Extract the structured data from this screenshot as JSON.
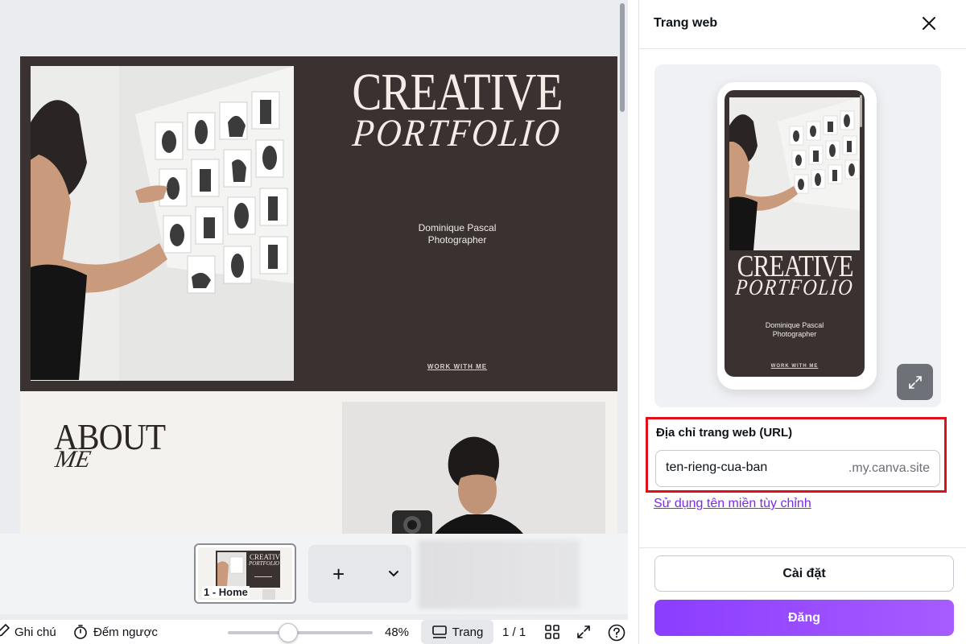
{
  "canvas": {
    "hero": {
      "title_line1": "CREATIVE",
      "title_line2": "PORTFOLIO",
      "name_line1": "Dominique Pascal",
      "name_line2": "Photographer",
      "cta": "WORK WITH ME"
    },
    "about": {
      "title": "ABOUT",
      "subtitle": "ME"
    }
  },
  "page_strip": {
    "thumbnail_label": "1 - Home",
    "thumbnail_title": "CREATIVE",
    "thumbnail_subtitle": "PORTFOLIO",
    "add_label": "+"
  },
  "toolbar": {
    "notes_label": "Ghi chú",
    "timer_label": "Đếm ngược",
    "zoom_label": "48%",
    "zoom_value": 48,
    "pages_label": "Trang",
    "page_counter": "1 / 1"
  },
  "panel": {
    "title": "Trang web",
    "preview": {
      "title_line1": "CREATIVE",
      "title_line2": "PORTFOLIO",
      "name_line1": "Dominique Pascal",
      "name_line2": "Photographer",
      "cta": "WORK WITH ME"
    },
    "url": {
      "label": "Địa chỉ trang web (URL)",
      "value": "ten-rieng-cua-ban",
      "suffix": ".my.canva.site",
      "highlight_color": "#e0101a"
    },
    "custom_domain_link": "Sử dụng tên miền tùy chỉnh",
    "settings_button": "Cài đặt",
    "publish_button": "Đăng",
    "accent_color": "#8b3dff"
  }
}
